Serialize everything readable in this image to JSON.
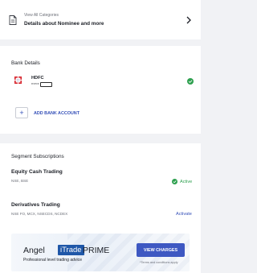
{
  "categories": {
    "small_label": "View All Categories",
    "title": "Details about Nominee and more"
  },
  "bank": {
    "heading": "Bank Details",
    "bank_name": "HDFC",
    "account_mask": "****",
    "add_label": "ADD BANK ACCOUNT"
  },
  "segments": {
    "heading": "Segment Subscriptions",
    "items": [
      {
        "title": "Equity Cash Trading",
        "sub": "NSE, BSE",
        "status": "Active"
      },
      {
        "title": "Derivatives Trading",
        "sub": "NSE FO, MCX, NSECDS, NCDEX",
        "action": "Activate"
      }
    ]
  },
  "banner": {
    "brand_1": "Angel",
    "brand_2": "iTrade",
    "brand_3": "PRIME",
    "tagline": "Professional level trading advice",
    "button": "VIEW CHARGES",
    "terms": "*Terms and conditions apply"
  },
  "colors": {
    "accent": "#3550b8",
    "success": "#2ea04f",
    "brand_blue": "#1f57a8",
    "background": "#f1f2f5"
  }
}
